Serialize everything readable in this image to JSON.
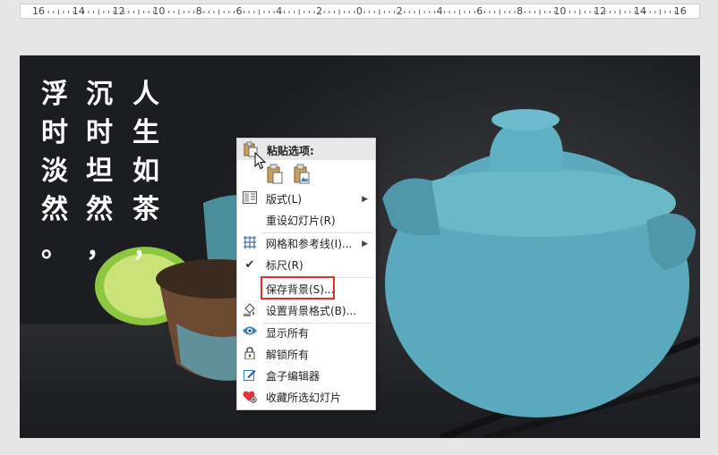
{
  "ruler": {
    "labels": [
      "16",
      "14",
      "12",
      "10",
      "8",
      "6",
      "4",
      "2",
      "0",
      "2",
      "4",
      "6",
      "8",
      "10",
      "12",
      "14",
      "16"
    ]
  },
  "slide": {
    "poem_columns": [
      [
        "人",
        "生",
        "如",
        "茶",
        "，"
      ],
      [
        "沉",
        "时",
        "坦",
        "然",
        "，"
      ],
      [
        "浮",
        "时",
        "淡",
        "然",
        "。"
      ]
    ]
  },
  "context_menu": {
    "paste_header": "粘贴选项:",
    "paste_options": [
      "keep-source-formatting-icon",
      "paste-as-picture-icon"
    ],
    "items": [
      {
        "label": "版式(L)",
        "icon": "layout-icon",
        "submenu": true
      },
      {
        "label": "重设幻灯片(R)",
        "icon": "",
        "submenu": false
      },
      {
        "label": "网格和参考线(I)...",
        "icon": "grid-icon",
        "submenu": true
      },
      {
        "label": "标尺(R)",
        "icon": "checkmark-icon",
        "submenu": false
      },
      {
        "label": "保存背景(S)...",
        "icon": "",
        "submenu": false
      },
      {
        "label": "设置背景格式(B)...",
        "icon": "format-background-icon",
        "submenu": false
      },
      {
        "label": "显示所有",
        "icon": "eye-icon",
        "submenu": false
      },
      {
        "label": "解锁所有",
        "icon": "lock-icon",
        "submenu": false
      },
      {
        "label": "盒子编辑器",
        "icon": "edit-icon",
        "submenu": false
      },
      {
        "label": "收藏所选幻灯片",
        "icon": "heart-add-icon",
        "submenu": false
      }
    ]
  },
  "colors": {
    "highlight_box": "#e0302c",
    "teapot": "#5aa9bd",
    "lime": "#8dc63f"
  }
}
